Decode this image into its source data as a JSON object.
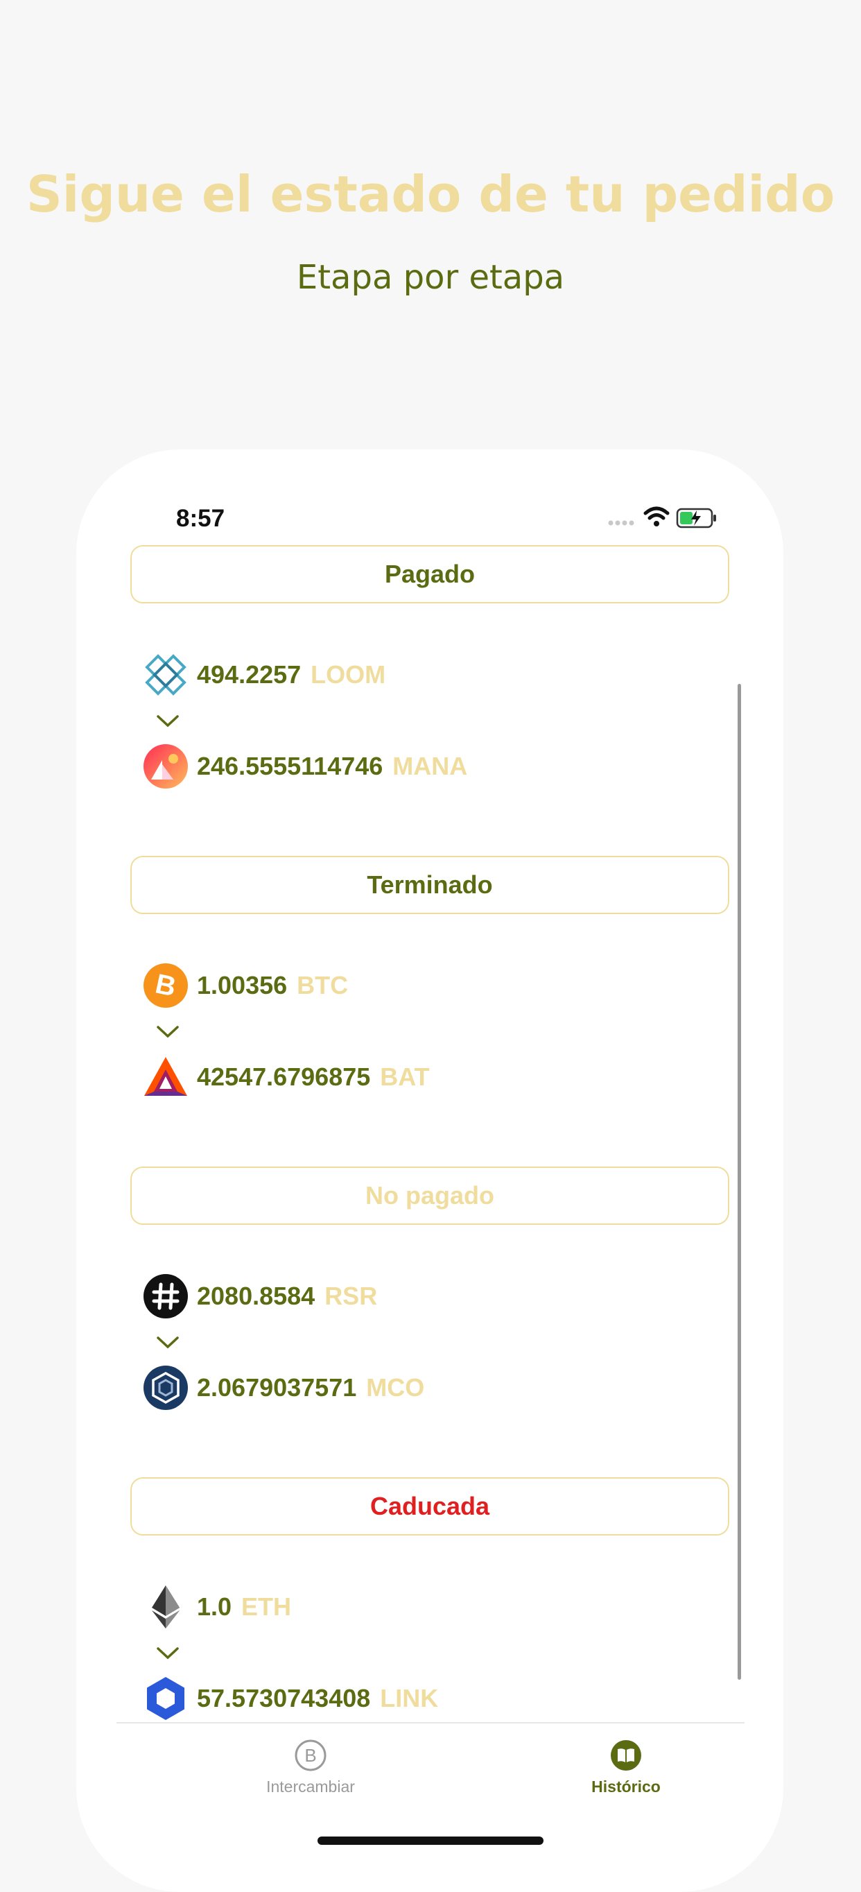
{
  "promo": {
    "headline": "Sigue el estado de tu pedido",
    "subheadline": "Etapa por etapa"
  },
  "status_bar": {
    "time": "8:57"
  },
  "orders": [
    {
      "status": "Pagado",
      "status_color": "#5a6b12",
      "from": {
        "amount": "494.2257",
        "symbol": "LOOM",
        "icon": "loom-icon"
      },
      "to": {
        "amount": "246.5555114746",
        "symbol": "MANA",
        "icon": "mana-icon"
      }
    },
    {
      "status": "Terminado",
      "status_color": "#5a6b12",
      "from": {
        "amount": "1.00356",
        "symbol": "BTC",
        "icon": "bitcoin-icon"
      },
      "to": {
        "amount": "42547.6796875",
        "symbol": "BAT",
        "icon": "bat-icon"
      }
    },
    {
      "status": "No pagado",
      "status_color": "#f0dc9c",
      "from": {
        "amount": "2080.8584",
        "symbol": "RSR",
        "icon": "rsr-icon"
      },
      "to": {
        "amount": "2.0679037571",
        "symbol": "MCO",
        "icon": "mco-icon"
      }
    },
    {
      "status": "Caducada",
      "status_color": "#e02020",
      "from": {
        "amount": "1.0",
        "symbol": "ETH",
        "icon": "ethereum-icon"
      },
      "to": {
        "amount": "57.5730743408",
        "symbol": "LINK",
        "icon": "chainlink-icon"
      }
    }
  ],
  "tabbar": {
    "exchange_label": "Intercambiar",
    "history_label": "Histórico"
  },
  "colors": {
    "accent_gold": "#f0dc9c",
    "accent_olive": "#5a6b12",
    "expired_red": "#e02020",
    "inactive_gray": "#9a9a9a"
  }
}
